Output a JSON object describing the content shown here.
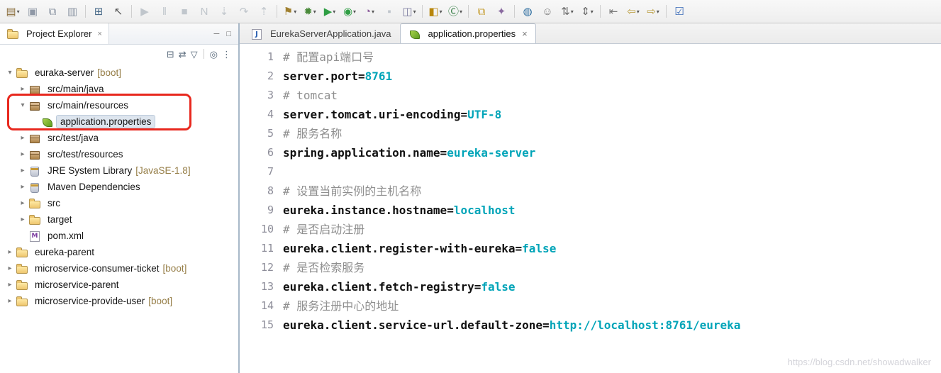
{
  "colors": {
    "key": "#111111",
    "value": "#00a4b8",
    "comment": "#8f8f8f",
    "decorator": "#957d46",
    "annotation": "#e8281e"
  },
  "toolbar": {
    "items": [
      {
        "name": "new-wizard",
        "glyph": "▤",
        "color": "#8a6d3b",
        "dropdown": true
      },
      {
        "name": "save",
        "glyph": "▣",
        "color": "#8f98a6"
      },
      {
        "name": "save-all",
        "glyph": "⧉",
        "color": "#8f98a6"
      },
      {
        "name": "print",
        "glyph": "▥",
        "color": "#8f98a6"
      },
      {
        "separator": true
      },
      {
        "name": "open-console",
        "glyph": "⊞",
        "color": "#4a6b8a"
      },
      {
        "name": "select-tool",
        "glyph": "↖",
        "color": "#555555"
      },
      {
        "separator": true
      },
      {
        "name": "resume",
        "glyph": "▶",
        "color": "#c0c6cc"
      },
      {
        "name": "suspend",
        "glyph": "‖",
        "color": "#c0c6cc"
      },
      {
        "name": "terminate",
        "glyph": "■",
        "color": "#c0c6cc"
      },
      {
        "name": "relaunch",
        "glyph": "N",
        "color": "#c0c6cc"
      },
      {
        "name": "step-into",
        "glyph": "⇣",
        "color": "#c0c6cc"
      },
      {
        "name": "step-over",
        "glyph": "↷",
        "color": "#c0c6cc"
      },
      {
        "name": "step-return",
        "glyph": "⇡",
        "color": "#c0c6cc"
      },
      {
        "separator": true
      },
      {
        "name": "external-tools",
        "glyph": "⚑",
        "color": "#a08030",
        "dropdown": true
      },
      {
        "name": "debug",
        "glyph": "✹",
        "color": "#4a8a3a",
        "dropdown": true
      },
      {
        "name": "run",
        "glyph": "▶",
        "color": "#2f9e44",
        "dropdown": true
      },
      {
        "name": "coverage",
        "glyph": "◉",
        "color": "#2f9e44",
        "dropdown": true
      },
      {
        "name": "profile",
        "glyph": "◔",
        "color": "#8a5a9a",
        "dropdown": true
      },
      {
        "name": "stop-server",
        "glyph": "▪",
        "color": "#c0c6cc"
      },
      {
        "name": "servers",
        "glyph": "◫",
        "color": "#7a7a9e",
        "dropdown": true
      },
      {
        "separator": true
      },
      {
        "name": "new-java-project",
        "glyph": "◧",
        "color": "#b8860b",
        "dropdown": true
      },
      {
        "name": "new-class",
        "glyph": "Ⓒ",
        "color": "#2f7a3f",
        "dropdown": true
      },
      {
        "separator": true
      },
      {
        "name": "open-folders",
        "glyph": "⧉",
        "color": "#c8a23a"
      },
      {
        "name": "magic-wand",
        "glyph": "✦",
        "color": "#8a6aa0"
      },
      {
        "separator": true
      },
      {
        "name": "world",
        "glyph": "◍",
        "color": "#2e6ea0"
      },
      {
        "name": "team",
        "glyph": "☺",
        "color": "#777777"
      },
      {
        "name": "sort-asc",
        "glyph": "⇅",
        "color": "#666666",
        "dropdown": true
      },
      {
        "name": "sort-tree",
        "glyph": "⇕",
        "color": "#666666",
        "dropdown": true
      },
      {
        "separator": true
      },
      {
        "name": "previous-edit",
        "glyph": "⇤",
        "color": "#777777"
      },
      {
        "name": "back",
        "glyph": "⇦",
        "color": "#b89a3a",
        "dropdown": true
      },
      {
        "name": "forward",
        "glyph": "⇨",
        "color": "#b89a3a",
        "dropdown": true
      },
      {
        "separator": true
      },
      {
        "name": "open-task",
        "glyph": "☑",
        "color": "#3a6ab8"
      }
    ]
  },
  "project_explorer": {
    "title": "Project Explorer",
    "close_glyph": "×",
    "window_controls": [
      {
        "name": "minimize-button",
        "glyph": "─"
      },
      {
        "name": "maximize-button",
        "glyph": "□"
      }
    ],
    "viewbar": [
      {
        "name": "collapse-all",
        "glyph": "⊟"
      },
      {
        "name": "link-with-editor",
        "glyph": "⇄"
      },
      {
        "name": "filter",
        "glyph": "▽"
      },
      {
        "separator": true
      },
      {
        "name": "focus",
        "glyph": "◎"
      },
      {
        "name": "view-menu",
        "glyph": "⋮"
      }
    ],
    "tree": [
      {
        "label": "euraka-server",
        "decorator": "[boot]",
        "level": 0,
        "state": "expanded",
        "icon": "folder"
      },
      {
        "label": "src/main/java",
        "level": 1,
        "state": "collapsed",
        "icon": "pkg"
      },
      {
        "label": "src/main/resources",
        "level": 1,
        "state": "expanded",
        "icon": "pkg"
      },
      {
        "label": "application.properties",
        "level": 2,
        "state": "none",
        "icon": "leaf",
        "selected": true
      },
      {
        "label": "src/test/java",
        "level": 1,
        "state": "collapsed",
        "icon": "pkg"
      },
      {
        "label": "src/test/resources",
        "level": 1,
        "state": "collapsed",
        "icon": "pkg"
      },
      {
        "label": "JRE System Library",
        "decorator": "[JavaSE-1.8]",
        "level": 1,
        "state": "collapsed",
        "icon": "lib"
      },
      {
        "label": "Maven Dependencies",
        "level": 1,
        "state": "collapsed",
        "icon": "lib"
      },
      {
        "label": "src",
        "level": 1,
        "state": "collapsed",
        "icon": "folder"
      },
      {
        "label": "target",
        "level": 1,
        "state": "collapsed",
        "icon": "folder"
      },
      {
        "label": "pom.xml",
        "level": 1,
        "state": "none",
        "icon": "mfile"
      },
      {
        "label": "eureka-parent",
        "level": 0,
        "state": "collapsed",
        "icon": "folder"
      },
      {
        "label": "microservice-consumer-ticket",
        "decorator": "[boot]",
        "level": 0,
        "state": "collapsed",
        "icon": "folder"
      },
      {
        "label": "microservice-parent",
        "level": 0,
        "state": "collapsed",
        "icon": "folder"
      },
      {
        "label": "microservice-provide-user",
        "decorator": "[boot]",
        "level": 0,
        "state": "collapsed",
        "icon": "folder"
      }
    ]
  },
  "editor": {
    "tabs": [
      {
        "label": "EurekaServerApplication.java",
        "active": false,
        "icon": "jfile"
      },
      {
        "label": "application.properties",
        "active": true,
        "icon": "leaf",
        "close_glyph": "×"
      }
    ],
    "lines": [
      {
        "num": "1",
        "comment": "# 配置api端口号"
      },
      {
        "num": "2",
        "key": "server.port",
        "value": "8761"
      },
      {
        "num": "3",
        "comment": "# tomcat"
      },
      {
        "num": "4",
        "key": "server.tomcat.uri-encoding",
        "value": "UTF-8"
      },
      {
        "num": "5",
        "comment": "# 服务名称"
      },
      {
        "num": "6",
        "key": "spring.application.name",
        "value": "eureka-server"
      },
      {
        "num": "7"
      },
      {
        "num": "8",
        "comment": "# 设置当前实例的主机名称"
      },
      {
        "num": "9",
        "key": "eureka.instance.hostname",
        "value": "localhost"
      },
      {
        "num": "10",
        "comment": "# 是否启动注册"
      },
      {
        "num": "11",
        "key": "eureka.client.register-with-eureka",
        "value": "false"
      },
      {
        "num": "12",
        "comment": "# 是否检索服务"
      },
      {
        "num": "13",
        "key": "eureka.client.fetch-registry",
        "value": "false"
      },
      {
        "num": "14",
        "comment": "# 服务注册中心的地址"
      },
      {
        "num": "15",
        "key": "eureka.client.service-url.default-zone",
        "value": "http://localhost:8761/eureka"
      }
    ]
  },
  "watermark": {
    "text": "https://blog.csdn.net/showadwalker"
  }
}
